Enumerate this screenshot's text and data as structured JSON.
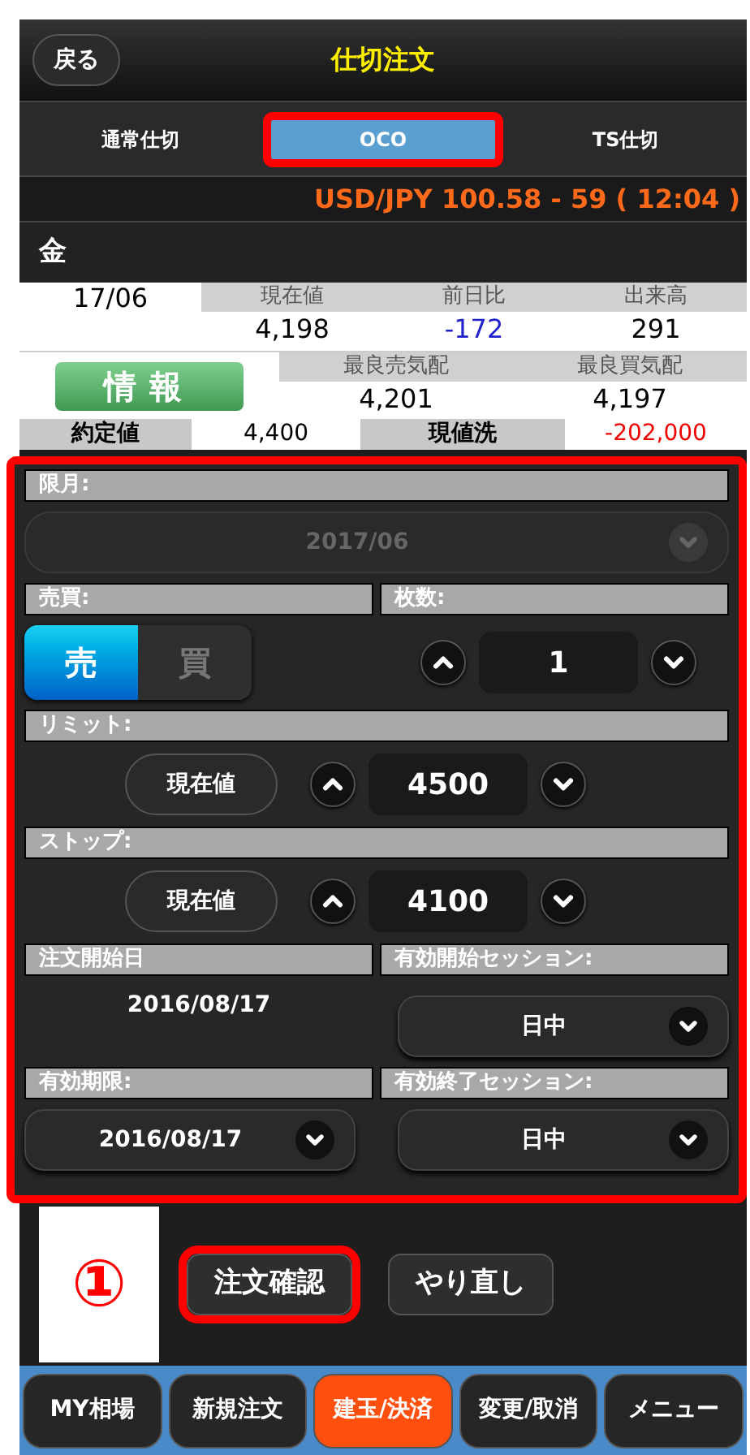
{
  "header": {
    "back": "戻る",
    "title": "仕切注文"
  },
  "tabs": [
    {
      "label": "通常仕切",
      "selected": false,
      "highlighted": false
    },
    {
      "label": "OCO",
      "selected": true,
      "highlighted": true
    },
    {
      "label": "TS仕切",
      "selected": false,
      "highlighted": false
    }
  ],
  "fx_rate": "USD/JPY 100.58 - 59 ( 12:04 )",
  "product": "金",
  "quote": {
    "month": "17/06",
    "info_button": "情報",
    "row1": [
      {
        "label": "現在値",
        "value": "4,198",
        "negative": false
      },
      {
        "label": "前日比",
        "value": "-172",
        "negative": true
      },
      {
        "label": "出来高",
        "value": "291",
        "negative": false
      }
    ],
    "row2": [
      {
        "label": "最良売気配",
        "value": "4,201"
      },
      {
        "label": "最良買気配",
        "value": "4,197"
      }
    ],
    "contract_label": "約定値",
    "contract_value": "4,400",
    "mtm_label": "現値洗",
    "mtm_value": "-202,000",
    "mtm_negative": true
  },
  "form": {
    "highlighted": true,
    "contract_month": {
      "label": "限月:",
      "value": "2017/06",
      "disabled": true
    },
    "side": {
      "label": "売買:",
      "options": [
        {
          "label": "売",
          "selected": true
        },
        {
          "label": "買",
          "selected": false
        }
      ]
    },
    "quantity": {
      "label": "枚数:",
      "value": "1"
    },
    "limit": {
      "label": "リミット:",
      "button": "現在値",
      "value": "4500"
    },
    "stop": {
      "label": "ストップ:",
      "button": "現在値",
      "value": "4100"
    },
    "start_date": {
      "label": "注文開始日",
      "value": "2016/08/17"
    },
    "start_session": {
      "label": "有効開始セッション:",
      "value": "日中"
    },
    "expiry": {
      "label": "有効期限:",
      "value": "2016/08/17"
    },
    "end_session": {
      "label": "有効終了セッション:",
      "value": "日中"
    }
  },
  "step_marker": "①",
  "actions": [
    {
      "label": "注文確認",
      "highlighted": true
    },
    {
      "label": "やり直し",
      "highlighted": false
    }
  ],
  "nav": [
    {
      "label": "MY相場",
      "selected": false
    },
    {
      "label": "新規注文",
      "selected": false
    },
    {
      "label": "建玉/決済",
      "selected": true
    },
    {
      "label": "変更/取消",
      "selected": false
    },
    {
      "label": "メニュー",
      "selected": false
    }
  ]
}
